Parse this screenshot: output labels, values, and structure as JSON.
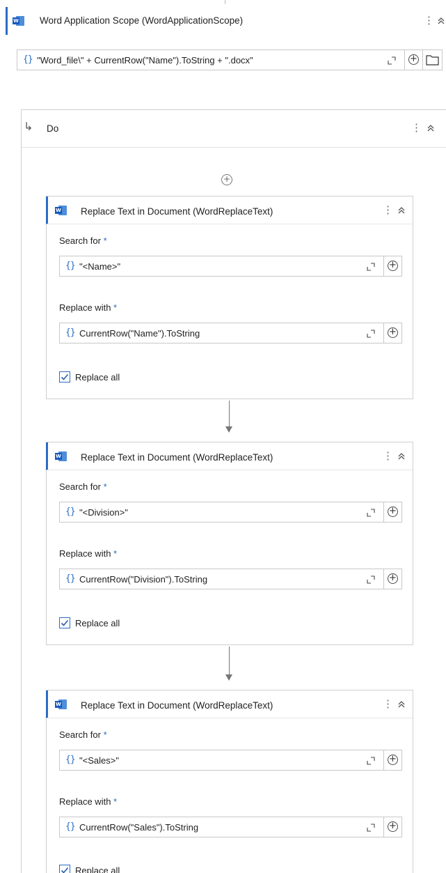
{
  "scope": {
    "title": "Word Application Scope (WordApplicationScope)",
    "icon": "word-icon",
    "file_path_value": "\"Word_file\\\" + CurrentRow(\"Name\").ToString + \".docx\""
  },
  "do_block": {
    "label": "Do"
  },
  "activities": [
    {
      "title": "Replace Text in Document (WordReplaceText)",
      "search_label": "Search for",
      "search_value": "\"<Name>\"",
      "replace_label": "Replace with",
      "replace_value": "CurrentRow(\"Name\").ToString",
      "replace_all_label": "Replace all",
      "replace_all_checked": true
    },
    {
      "title": "Replace Text in Document (WordReplaceText)",
      "search_label": "Search for",
      "search_value": "\"<Division>\"",
      "replace_label": "Replace with",
      "replace_value": "CurrentRow(\"Division\").ToString",
      "replace_all_label": "Replace all",
      "replace_all_checked": true
    },
    {
      "title": "Replace Text in Document (WordReplaceText)",
      "search_label": "Search for",
      "search_value": "\"<Sales>\"",
      "replace_label": "Replace with",
      "replace_value": "CurrentRow(\"Sales\").ToString",
      "replace_all_label": "Replace all",
      "replace_all_checked": true
    }
  ],
  "required_marker": "*",
  "colors": {
    "accent": "#2b6cc4",
    "word_blue": "#185abd",
    "border": "#c8c8c8"
  }
}
